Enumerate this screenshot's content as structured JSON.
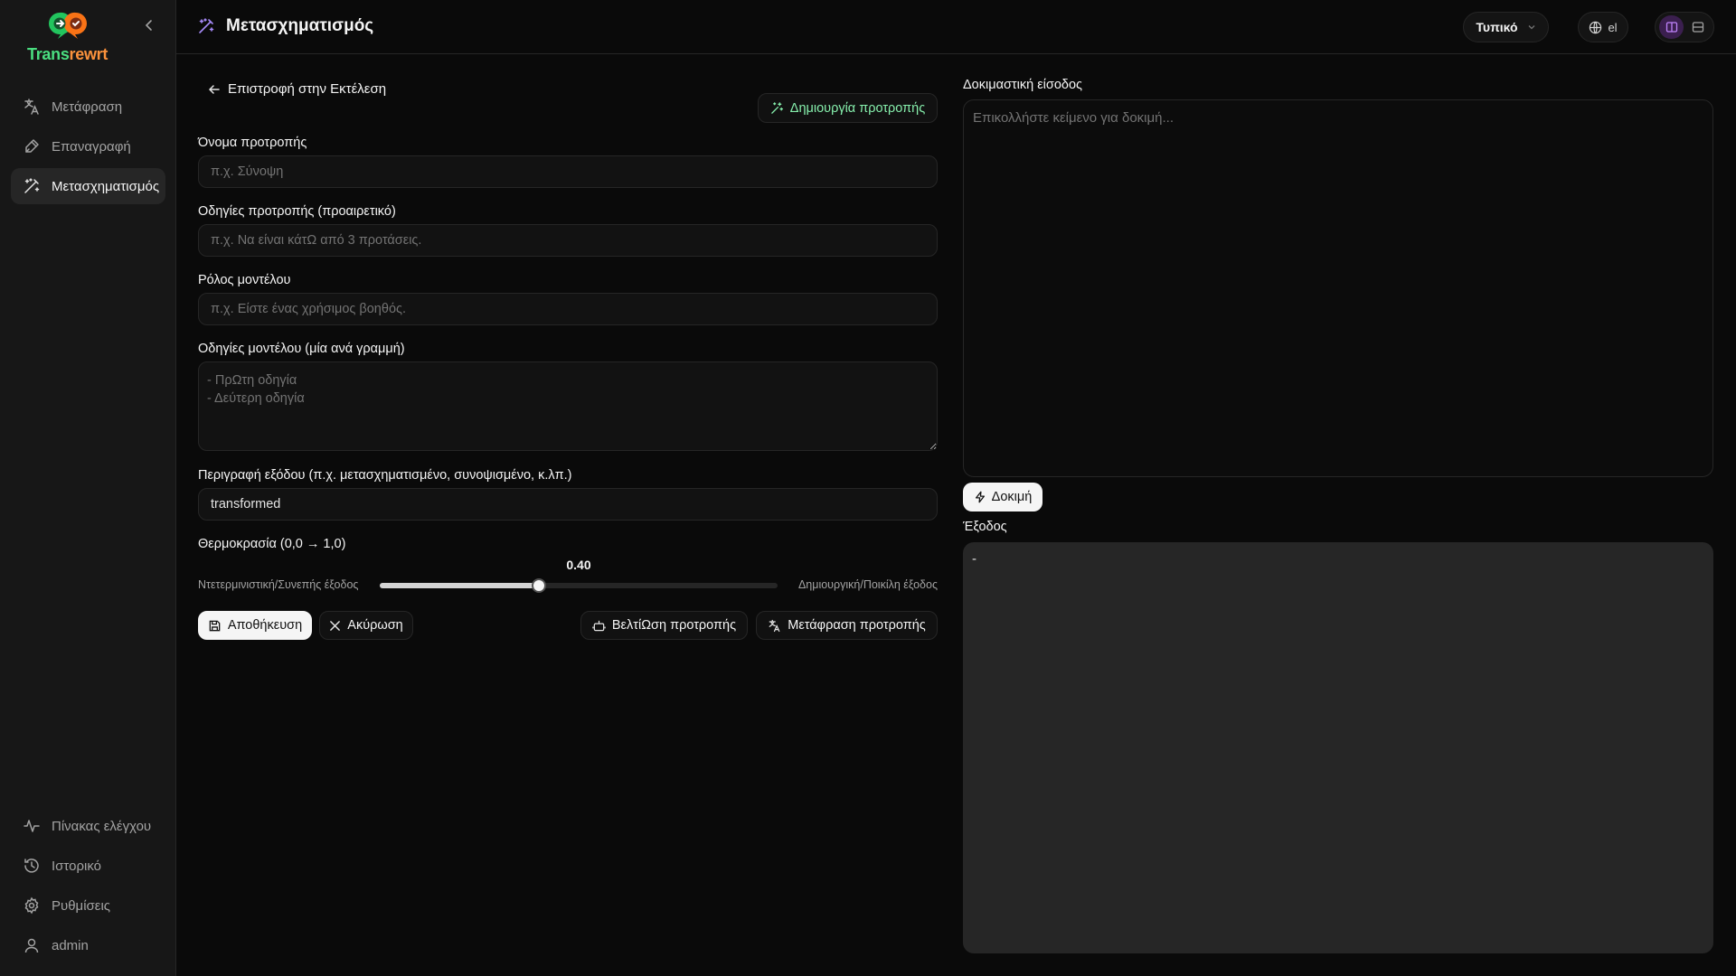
{
  "app": {
    "logo_part1": "Trans",
    "logo_part2": "rewrt",
    "brand_green": "#4ade80",
    "brand_orange": "#fb923c"
  },
  "sidebar": {
    "top_items": [
      {
        "label": "Μετάφραση",
        "icon": "translate-icon",
        "active": false
      },
      {
        "label": "Επαναγραφή",
        "icon": "pen-icon",
        "active": false
      },
      {
        "label": "Μετασχηματισμός",
        "icon": "magic-wand-icon",
        "active": true
      }
    ],
    "bottom_items": [
      {
        "label": "Πίνακας ελέγχου",
        "icon": "activity-icon"
      },
      {
        "label": "Ιστορικό",
        "icon": "history-icon"
      },
      {
        "label": "Ρυθμίσεις",
        "icon": "gear-icon"
      },
      {
        "label": "admin",
        "icon": "user-icon"
      }
    ]
  },
  "header": {
    "title": "Μετασχηματισμός",
    "mode": "Τυπικό",
    "language": "el"
  },
  "form": {
    "back_label": "Επιστροφή στην Εκτέλεση",
    "create_label": "Δημιουργία προτροπής",
    "prompt_name": {
      "label": "Όνομα προτροπής",
      "placeholder": "π.χ. Σύνοψη",
      "value": ""
    },
    "prompt_instructions": {
      "label": "Οδηγίες προτροπής (προαιρετικό)",
      "placeholder": "π.χ. Να είναι κάτΩ από 3 προτάσεις.",
      "value": ""
    },
    "model_role": {
      "label": "Ρόλος μοντέλου",
      "placeholder": "π.χ. Είστε ένας χρήσιμος βοηθός.",
      "value": ""
    },
    "model_instructions": {
      "label": "Οδηγίες μοντέλου (μία ανά γραμμή)",
      "placeholder": "- ΠρΩτη οδηγία\n- Δεύτερη οδηγία",
      "value": ""
    },
    "output_description": {
      "label": "Περιγραφή εξόδου (π.χ. μετασχηματισμένο, συνοψισμένο, κ.λπ.)",
      "placeholder": "",
      "value": "transformed"
    },
    "temperature": {
      "label": "Θερμοκρασία (0,0 → 1,0)",
      "value": 0.4,
      "value_text": "0.40",
      "left_hint": "Ντετερμινιστική/Συνεπής έξοδος",
      "right_hint": "Δημιουργική/Ποικίλη έξοδος"
    },
    "save_label": "Αποθήκευση",
    "cancel_label": "Ακύρωση",
    "improve_label": "ΒελτίΩση προτροπής",
    "translate_label": "Μετάφραση προτροπής"
  },
  "test_panel": {
    "input_label": "Δοκιμαστική είσοδος",
    "input_placeholder": "Επικολλήστε κείμενο για δοκιμή...",
    "test_button": "Δοκιμή",
    "output_label": "Έξοδος",
    "output_value": "-"
  }
}
